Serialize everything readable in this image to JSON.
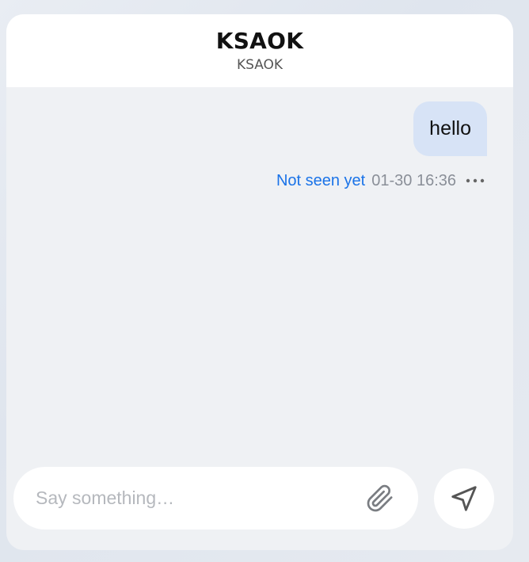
{
  "header": {
    "title": "KSAOK",
    "subtitle": "KSAOK"
  },
  "messages": [
    {
      "text": "hello",
      "status": "Not seen yet",
      "timestamp": "01-30 16:36",
      "menu_icon": "more-horizontal-icon"
    }
  ],
  "composer": {
    "value": "",
    "placeholder": "Say something…",
    "attach_icon": "paperclip-icon",
    "send_icon": "send-icon"
  },
  "colors": {
    "accent": "#1a73e8",
    "bubble": "#d7e3f6",
    "panel": "#eff1f4",
    "header": "#ffffff"
  }
}
